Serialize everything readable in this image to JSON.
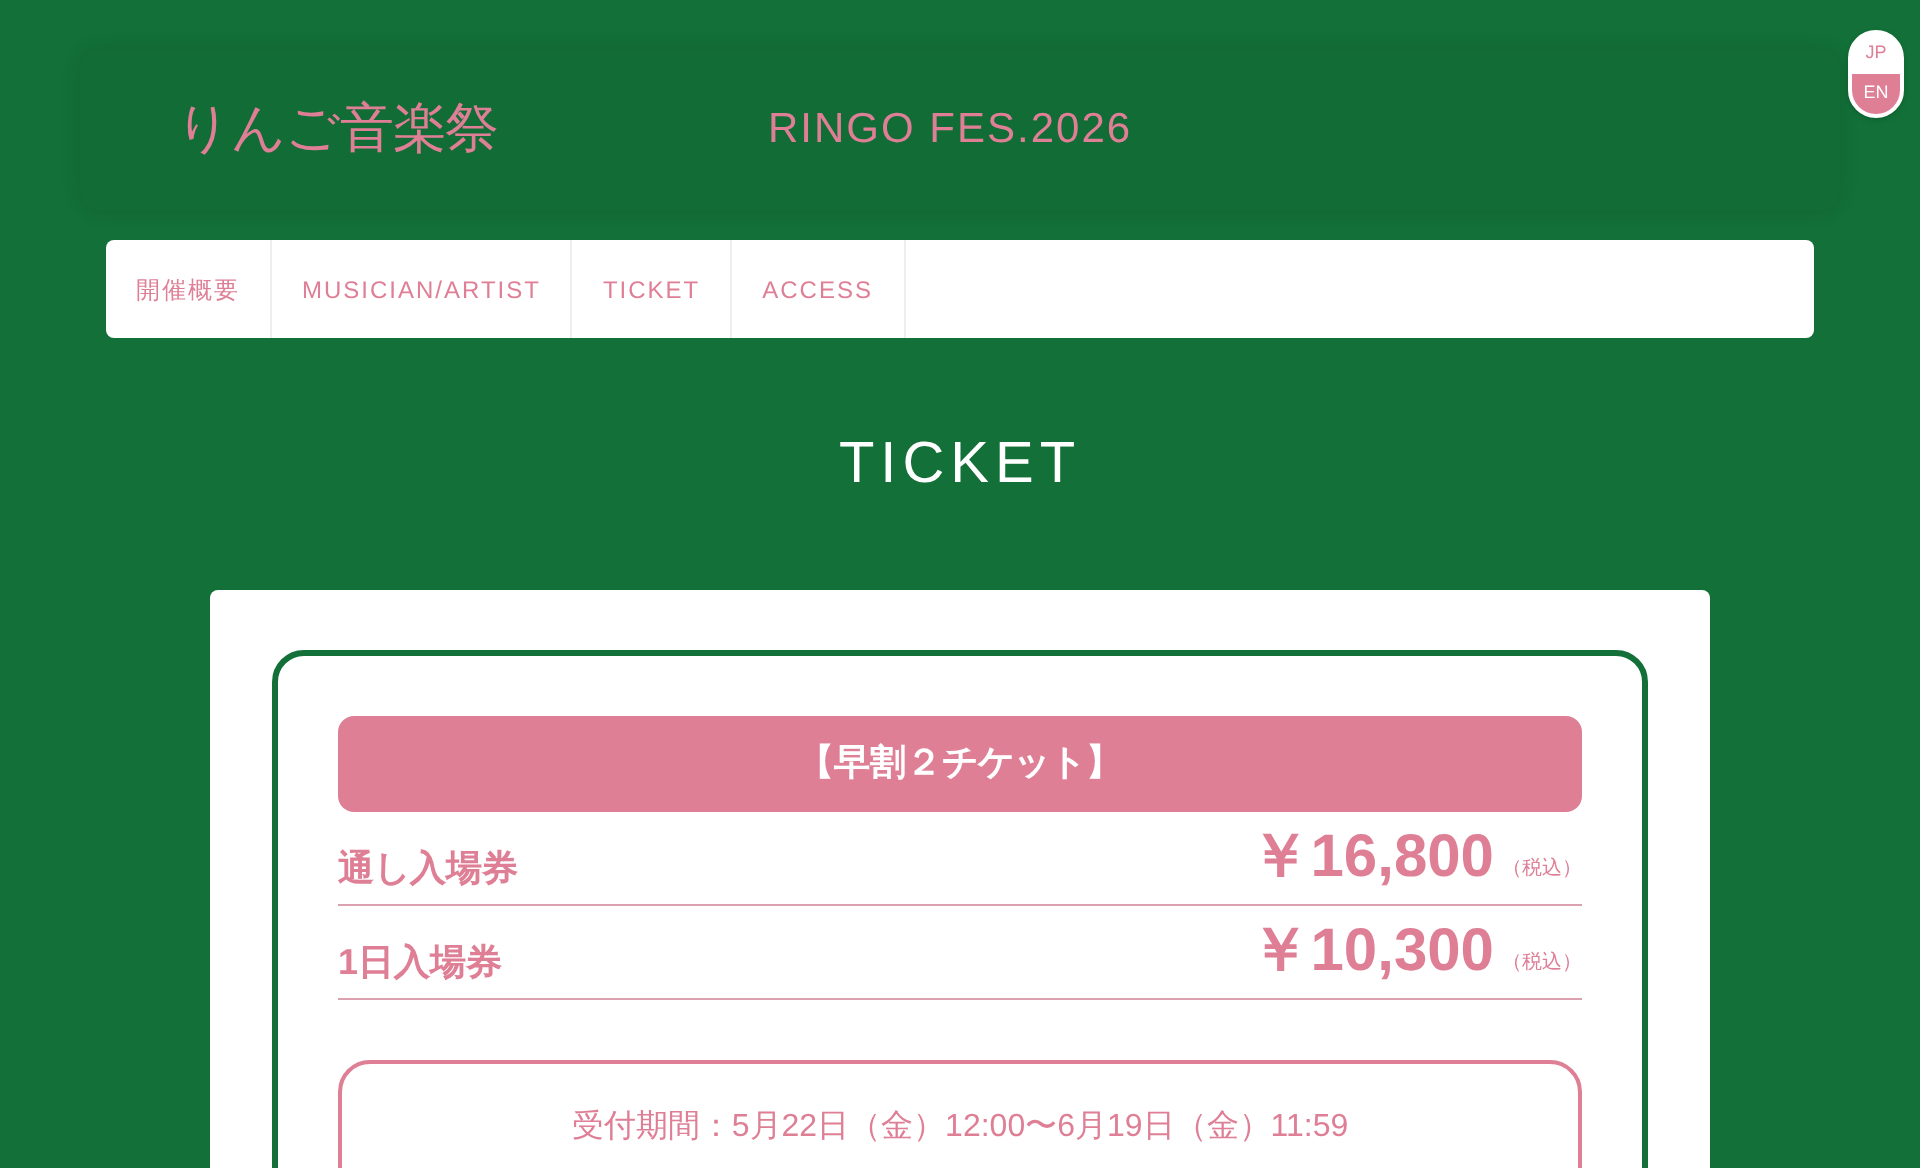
{
  "header": {
    "logo": "りんご音楽祭",
    "title": "RINGO FES.2026"
  },
  "language_toggle": [
    {
      "label": "JP",
      "selected": false
    },
    {
      "label": "EN",
      "selected": true
    }
  ],
  "nav": {
    "items": [
      "開催概要",
      "MUSICIAN/ARTIST",
      "TICKET",
      "ACCESS"
    ]
  },
  "page_title": "TICKET",
  "ticket": {
    "heading": "【早割２チケット】",
    "prices": [
      {
        "name": "通し入場券",
        "price": "￥16,800",
        "tax": "（税込）"
      },
      {
        "name": "1日入場券",
        "price": "￥10,300",
        "tax": "（税込）"
      }
    ],
    "period": "受付期間：5月22日（金）12:00〜6月19日（金）11:59"
  }
}
